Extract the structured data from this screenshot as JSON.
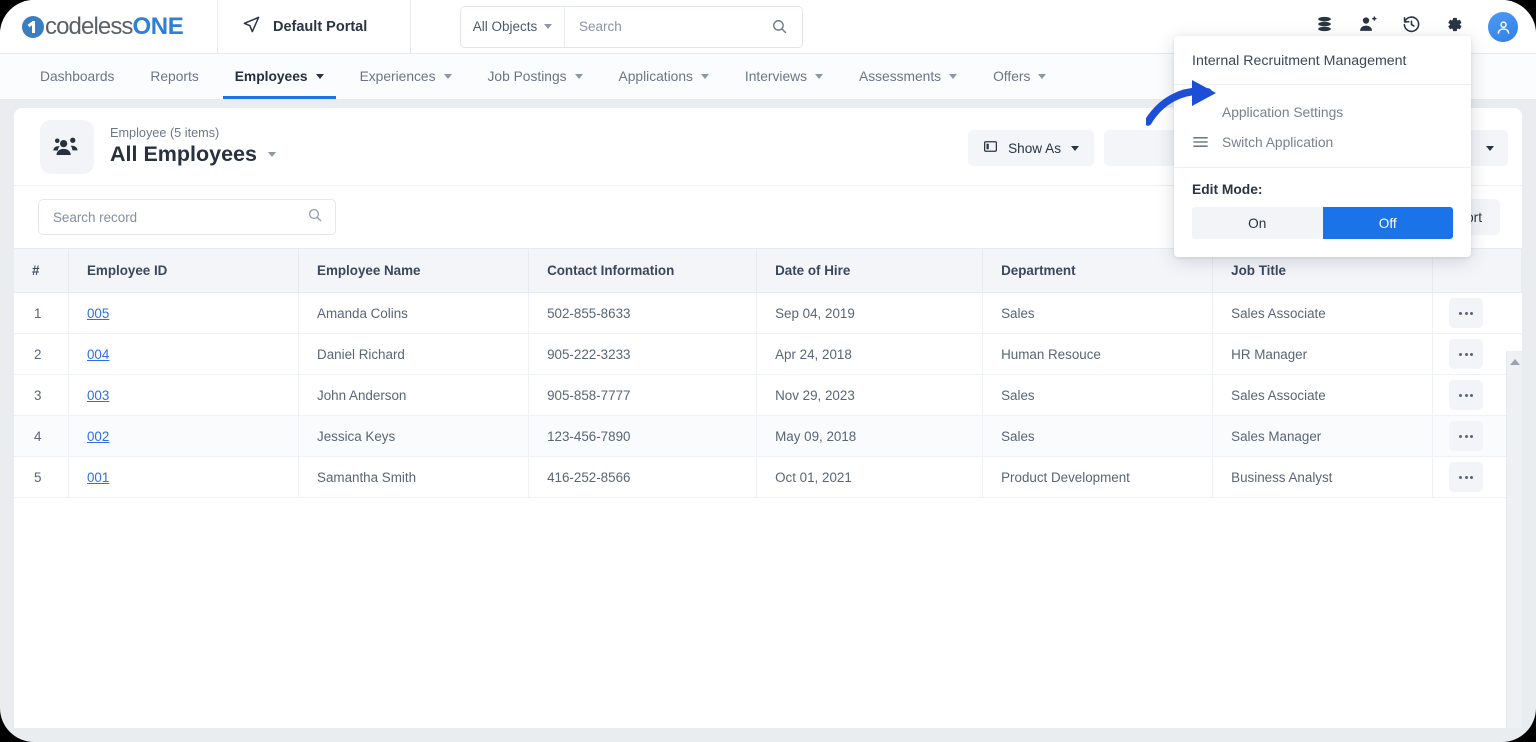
{
  "brand": {
    "logo_primary": "codeless",
    "logo_accent": "ONE",
    "logo_icon": "circle-one-icon",
    "accent_color": "#2f7fd4"
  },
  "topbar": {
    "portal_name": "Default Portal",
    "portal_icon": "paper-plane-icon",
    "search": {
      "scope_label": "All Objects",
      "placeholder": "Search",
      "value": "",
      "icon": "search-icon"
    },
    "icons": [
      {
        "name": "database-icon",
        "label": "Data"
      },
      {
        "name": "add-user-icon",
        "label": "Add User"
      },
      {
        "name": "history-icon",
        "label": "History"
      },
      {
        "name": "gear-icon",
        "label": "Settings"
      },
      {
        "name": "user-avatar-icon",
        "label": "Account"
      }
    ]
  },
  "nav": {
    "items": [
      {
        "label": "Dashboards",
        "has_caret": false,
        "active": false
      },
      {
        "label": "Reports",
        "has_caret": false,
        "active": false
      },
      {
        "label": "Employees",
        "has_caret": true,
        "active": true
      },
      {
        "label": "Experiences",
        "has_caret": true,
        "active": false
      },
      {
        "label": "Job Postings",
        "has_caret": true,
        "active": false
      },
      {
        "label": "Applications",
        "has_caret": true,
        "active": false
      },
      {
        "label": "Interviews",
        "has_caret": true,
        "active": false
      },
      {
        "label": "Assessments",
        "has_caret": true,
        "active": false
      },
      {
        "label": "Offers",
        "has_caret": true,
        "active": false
      }
    ]
  },
  "page": {
    "object_icon": "people-group-icon",
    "subtitle": "Employee (5 items)",
    "title": "All Employees",
    "show_as_label": "Show As",
    "show_as_icon": "layout-panel-icon",
    "export_label": "Export",
    "record_search_placeholder": "Search record",
    "record_search_value": ""
  },
  "table": {
    "columns": [
      "#",
      "Employee ID",
      "Employee Name",
      "Contact Information",
      "Date of Hire",
      "Department",
      "Job Title",
      ""
    ],
    "rows": [
      {
        "num": "1",
        "id": "005",
        "name": "Amanda Colins",
        "contact": "502-855-8633",
        "hire": "Sep 04, 2019",
        "dept": "Sales",
        "job": "Sales Associate"
      },
      {
        "num": "2",
        "id": "004",
        "name": "Daniel Richard",
        "contact": "905-222-3233",
        "hire": "Apr 24, 2018",
        "dept": "Human Resouce",
        "job": "HR Manager"
      },
      {
        "num": "3",
        "id": "003",
        "name": "John Anderson",
        "contact": "905-858-7777",
        "hire": "Nov 29, 2023",
        "dept": "Sales",
        "job": "Sales Associate"
      },
      {
        "num": "4",
        "id": "002",
        "name": "Jessica Keys",
        "contact": "123-456-7890",
        "hire": "May 09, 2018",
        "dept": "Sales",
        "job": "Sales Manager"
      },
      {
        "num": "5",
        "id": "001",
        "name": "Samantha Smith",
        "contact": "416-252-8566",
        "hire": "Oct 01, 2021",
        "dept": "Product Development",
        "job": "Business Analyst"
      }
    ],
    "row_action_icon": "ellipsis-icon"
  },
  "dropdown": {
    "app_title": "Internal Recruitment Management",
    "items": [
      {
        "label": "Application Settings",
        "icon": "gear-settings-icon"
      },
      {
        "label": "Switch Application",
        "icon": "hamburger-icon"
      }
    ],
    "edit_mode_label": "Edit Mode:",
    "toggle_on": "On",
    "toggle_off": "Off",
    "toggle_selected": "Off",
    "toggle_active_color": "#1a73e8"
  },
  "annotation": {
    "arrow_icon": "curved-arrow-icon",
    "arrow_color": "#1d4ed8",
    "points_to": "Application Settings"
  }
}
